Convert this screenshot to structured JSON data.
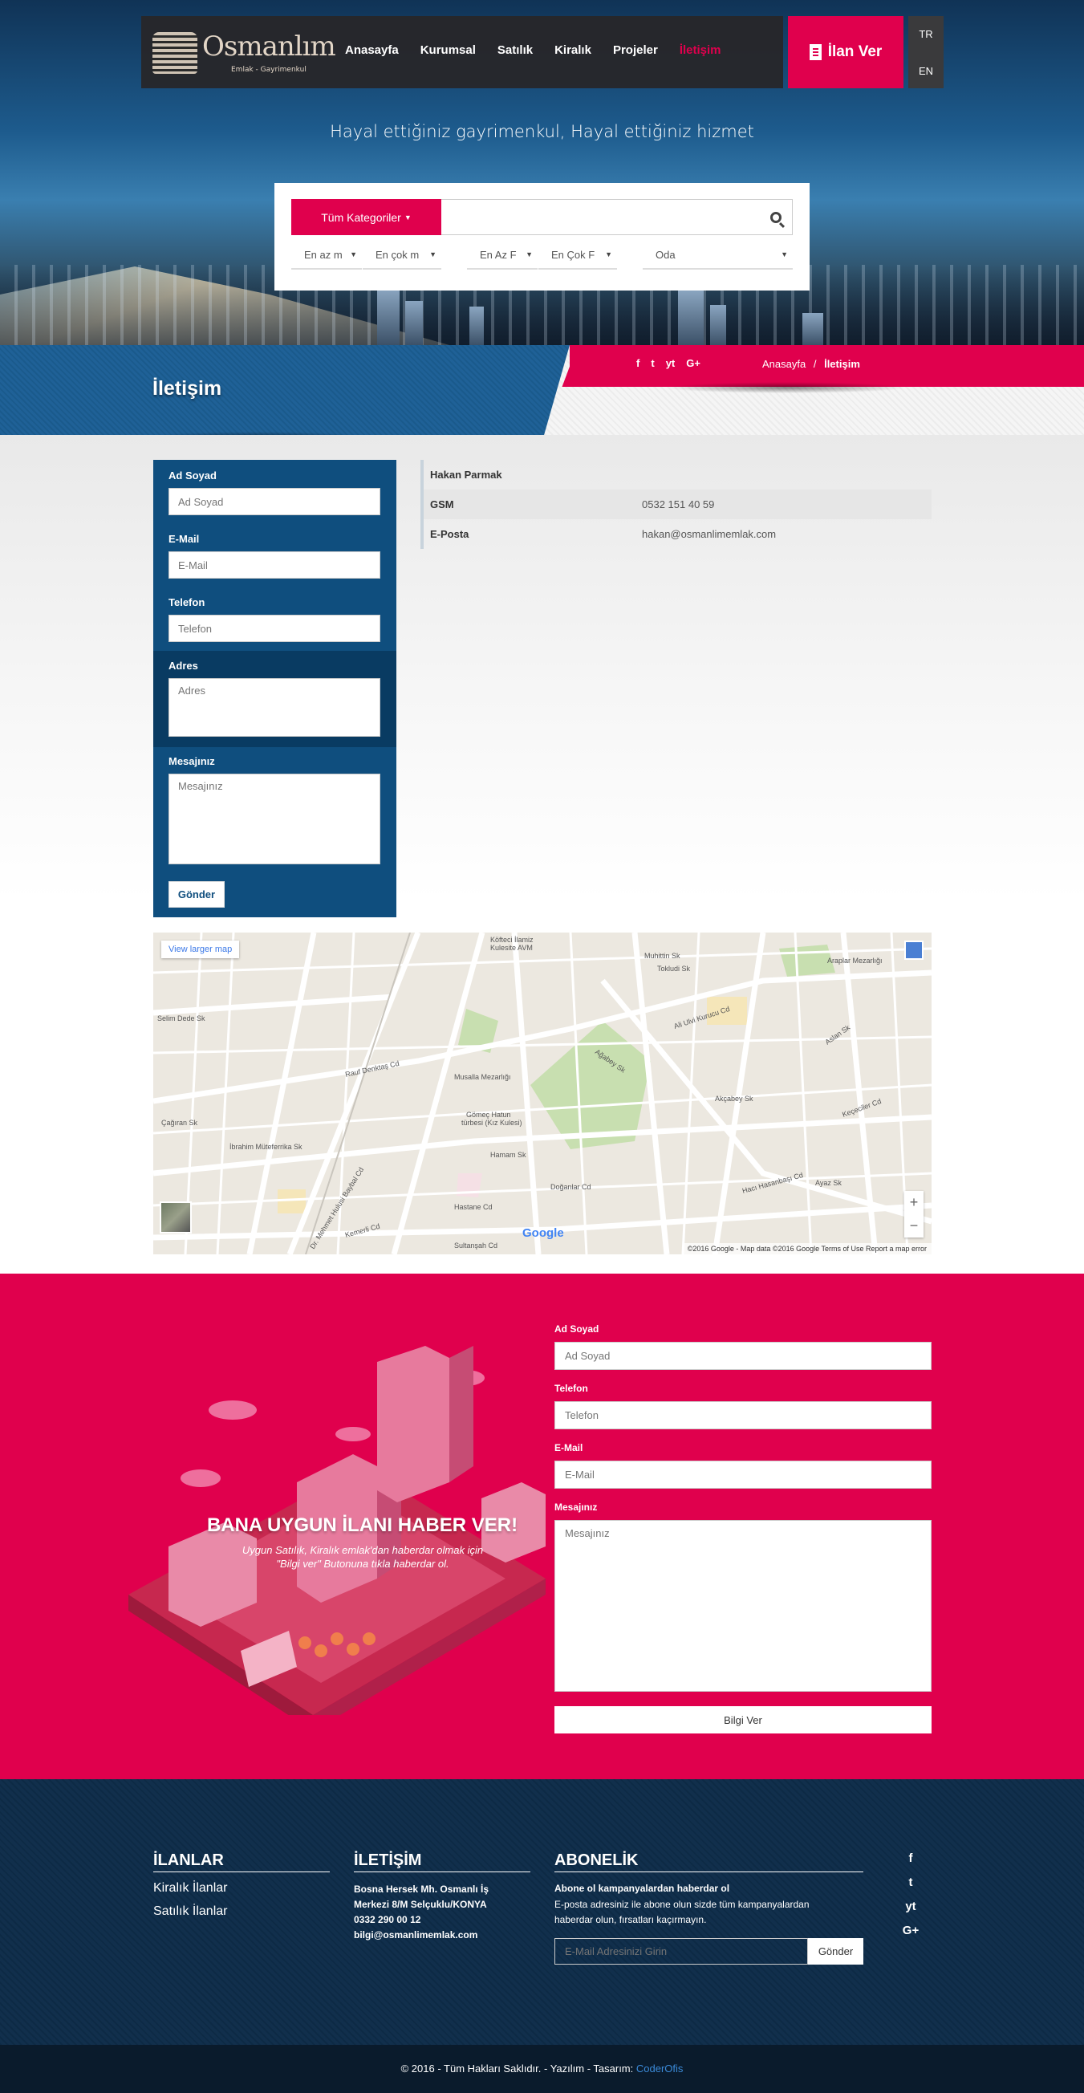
{
  "logo": {
    "name": "Osmanlım",
    "sub": "Emlak - Gayrimenkul"
  },
  "nav": {
    "items": [
      {
        "label": "Anasayfa",
        "active": false
      },
      {
        "label": "Kurumsal",
        "active": false
      },
      {
        "label": "Satılık",
        "active": false
      },
      {
        "label": "Kiralık",
        "active": false
      },
      {
        "label": "Projeler",
        "active": false
      },
      {
        "label": "İletişim",
        "active": true
      }
    ],
    "ilan_ver": "İlan Ver",
    "languages": [
      "TR",
      "EN"
    ]
  },
  "hero": {
    "tagline": "Hayal ettiğiniz gayrimenkul, Hayal ettiğiniz hizmet"
  },
  "search": {
    "category_button": "Tüm Kategoriler",
    "input_value": "",
    "filters": [
      "En az m",
      "En çok m",
      "En Az F",
      "En Çok F",
      "Oda"
    ]
  },
  "page": {
    "title": "İletişim",
    "socials": [
      "f",
      "t",
      "yt",
      "G+"
    ],
    "breadcrumb": {
      "home": "Anasayfa",
      "separator": "/",
      "current": "İletişim"
    }
  },
  "contact_form": {
    "fields": [
      {
        "label": "Ad Soyad",
        "placeholder": "Ad Soyad"
      },
      {
        "label": "E-Mail",
        "placeholder": "E-Mail"
      },
      {
        "label": "Telefon",
        "placeholder": "Telefon"
      },
      {
        "label": "Adres",
        "placeholder": "Adres"
      },
      {
        "label": "Mesajınız",
        "placeholder": "Mesajınız"
      }
    ],
    "submit": "Gönder"
  },
  "contact_info": {
    "name": "Hakan Parmak",
    "rows": [
      {
        "key": "GSM",
        "value": "0532 151 40 59"
      },
      {
        "key": "E-Posta",
        "value": "hakan@osmanlimemlak.com"
      }
    ]
  },
  "map": {
    "link": "View larger map",
    "footer": "©2016 Google - Map data ©2016 Google   Terms of Use   Report a map error",
    "logo": "Google",
    "labels": [
      "Köfteci İlamiz Kulesite AVM",
      "Muhittin Sk",
      "Tokludi Sk",
      "Araplar Mezarlığı",
      "Rauf Denktaş Cd",
      "Musalla Mezarlığı",
      "Gömeç Hatun türbesi (Kız Kulesi)",
      "Hamam Sk",
      "Hastane Cd",
      "Sultanşah Cd",
      "Ayaz Sk",
      "Keçeciler Cd",
      "Hacı Hasanbaşı Cd",
      "Aslan Sk",
      "Çağıran Sk",
      "İbrahim Müteferrika Sk",
      "Dr. Mehmet Hulusi Baybal Cd",
      "Selim Dede Sk",
      "Ali Ulvi Kurucu Cd",
      "Akçabey Sk",
      "Ağabey Sk",
      "Doğanlar Cd",
      "Kemerli Cd"
    ],
    "zoom_in": "+",
    "zoom_out": "−"
  },
  "promo": {
    "title": "BANA UYGUN İLANI HABER VER!",
    "sub1": "Uygun Satılık, Kiralık emlak'dan haberdar olmak için",
    "sub2": "\"Bilgi ver\" Butonuna tıkla haberdar ol.",
    "fields": [
      {
        "label": "Ad Soyad",
        "placeholder": "Ad Soyad"
      },
      {
        "label": "Telefon",
        "placeholder": "Telefon"
      },
      {
        "label": "E-Mail",
        "placeholder": "E-Mail"
      },
      {
        "label": "Mesajınız",
        "placeholder": "Mesajınız"
      }
    ],
    "submit": "Bilgi Ver"
  },
  "footer": {
    "ilanlar": {
      "title": "İLANLAR",
      "links": [
        "Kiralık İlanlar",
        "Satılık İlanlar"
      ]
    },
    "iletisim": {
      "title": "İLETİŞİM",
      "address1": "Bosna Hersek Mh. Osmanlı İş",
      "address2": "Merkezi 8/M Selçuklu/KONYA",
      "phone": "0332 290 00 12",
      "email": "bilgi@osmanlimemlak.com"
    },
    "abonelik": {
      "title": "ABONELİK",
      "headline": "Abone ol kampanyalardan haberdar ol",
      "text1": "E-posta adresiniz ile abone olun sizde tüm kampanyalardan",
      "text2": "haberdar olun, fırsatları kaçırmayın.",
      "placeholder": "E-Mail Adresinizi Girin",
      "button": "Gönder"
    },
    "socials": [
      "f",
      "t",
      "yt",
      "G+"
    ]
  },
  "copyright": {
    "text": "© 2016 - Tüm Hakları Saklıdır. - Yazılım - Tasarım:",
    "link": "CoderOfis"
  },
  "colors": {
    "accent": "#e0004d",
    "blue": "#0f4e7e",
    "footer": "#0d2a45"
  }
}
